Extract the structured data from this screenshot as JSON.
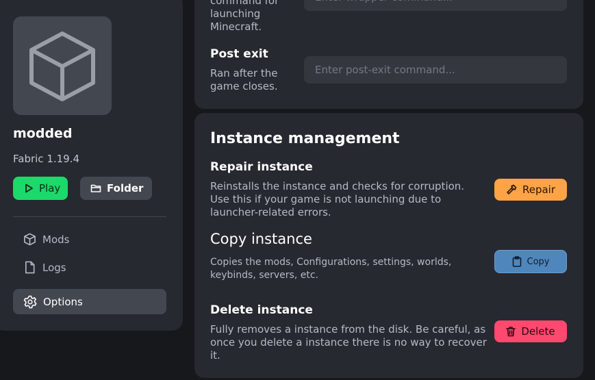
{
  "instance": {
    "name": "modded",
    "version": "Fabric 1.19.4",
    "icon": "cube-icon"
  },
  "sidebar": {
    "play_label": "Play",
    "folder_label": "Folder",
    "nav": [
      {
        "label": "Mods",
        "icon": "box-icon"
      },
      {
        "label": "Logs",
        "icon": "file-icon"
      },
      {
        "label": "Options",
        "icon": "gear-icon",
        "active": true
      }
    ]
  },
  "hooks": {
    "wrapper_desc": "command for launching Minecraft.",
    "wrapper_placeholder": "Enter wrapper command...",
    "post_exit_title": "Post exit",
    "post_exit_desc": "Ran after the game closes.",
    "post_exit_placeholder": "Enter post-exit command..."
  },
  "management": {
    "title": "Instance management",
    "repair": {
      "title": "Repair instance",
      "desc": "Reinstalls the instance and checks for corruption. Use this if your game is not launching due to launcher-related errors.",
      "button": "Repair"
    },
    "copy": {
      "title": "Copy instance",
      "desc": "Copies the mods, Configurations, settings, worlds, keybinds, servers, etc.",
      "button": "Copy"
    },
    "delete": {
      "title": "Delete instance",
      "desc": "Fully removes a instance from the disk. Be careful, as once you delete a instance there is no way to recover it.",
      "button": "Delete"
    }
  },
  "colors": {
    "play": "#1bd96a",
    "repair": "#ffa347",
    "copy": "#4f86bb",
    "delete": "#ff496e"
  }
}
